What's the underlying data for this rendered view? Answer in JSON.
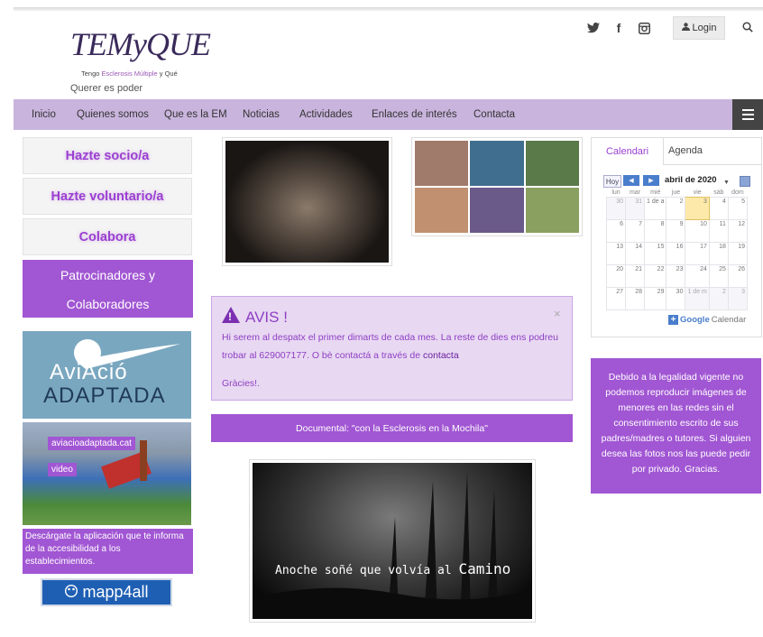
{
  "header": {
    "logo_text": "TEMyQUE",
    "logo_sub_prefix": "Tengo",
    "logo_sub_accent": "Esclerosis Múltiple",
    "logo_sub_suffix": "y Qué",
    "motto": "Querer es poder",
    "social_icons": [
      "twitter-icon",
      "facebook-icon",
      "instagram-icon"
    ],
    "twitter_glyph": "𝕥",
    "facebook_glyph": "f",
    "instagram_glyph": "◎",
    "login_label": "Login",
    "search_glyph": "⚲"
  },
  "nav": {
    "items": [
      "Inicio",
      "Quienes somos",
      "Que es la EM",
      "Noticias",
      "Actividades",
      "Enlaces de interés",
      "Contacta"
    ]
  },
  "sidebar": {
    "socio": "Hazte socio/a",
    "voluntario": "Hazte voluntario/a",
    "colabora": "Colabora",
    "patro_line1": "Patrocinadores y",
    "patro_line2": "Colaboradores",
    "avi_word1": "AviAció",
    "avi_word2": "ADAPTADA",
    "avi_link": "aviacioadaptada.cat",
    "video_link": "video",
    "descarga": "Descárgate la aplicación que te informa de la accesibilidad a los establecimientos.",
    "mapp": "mapp4all"
  },
  "avis": {
    "title": "AVIS !",
    "excl": "!",
    "close": "×",
    "text_before": "Hi serem al despatx el primer dimarts de cada mes. La reste de dies ens podreu trobar al 629007177. O bè contactá a través de",
    "link": "contacta",
    "thanks": "Gràcies!."
  },
  "documental": "Documental: \"con la Esclerosis en la Mochila\"",
  "video": {
    "caption_small": "Anoche soñé que volvía al",
    "caption_big": "Camino"
  },
  "calendar": {
    "tab_active": "Calendari",
    "tab_other": "Agenda",
    "hoy": "Hoy",
    "prev": "◀",
    "next": "▶",
    "month": "abril de 2020",
    "dropdown": "▼",
    "weekdays": [
      "lun",
      "mar",
      "mié",
      "jue",
      "vie",
      "sáb",
      "dom"
    ],
    "weeks": [
      [
        "30",
        "31",
        "1 de a",
        "2",
        "3",
        "4",
        "5"
      ],
      [
        "6",
        "7",
        "8",
        "9",
        "10",
        "11",
        "12"
      ],
      [
        "13",
        "14",
        "15",
        "16",
        "17",
        "18",
        "19"
      ],
      [
        "20",
        "21",
        "22",
        "23",
        "24",
        "25",
        "26"
      ],
      [
        "27",
        "28",
        "29",
        "30",
        "1 de m",
        "2",
        "3"
      ]
    ],
    "google_plus": "+",
    "google_label": "Google",
    "calendar_label": "Calendar"
  },
  "notice": "Debido a la legalidad vigente no podemos reproducir imágenes de menores en las redes sin el consentimiento escrito de sus padres/madres o tutores. Si alguien desea las fotos nos las puede pedir por privado. Gracias.",
  "colors": {
    "accent": "#a156d3",
    "nav": "#c9b4dd",
    "avis_bg": "#e8d8f2"
  }
}
